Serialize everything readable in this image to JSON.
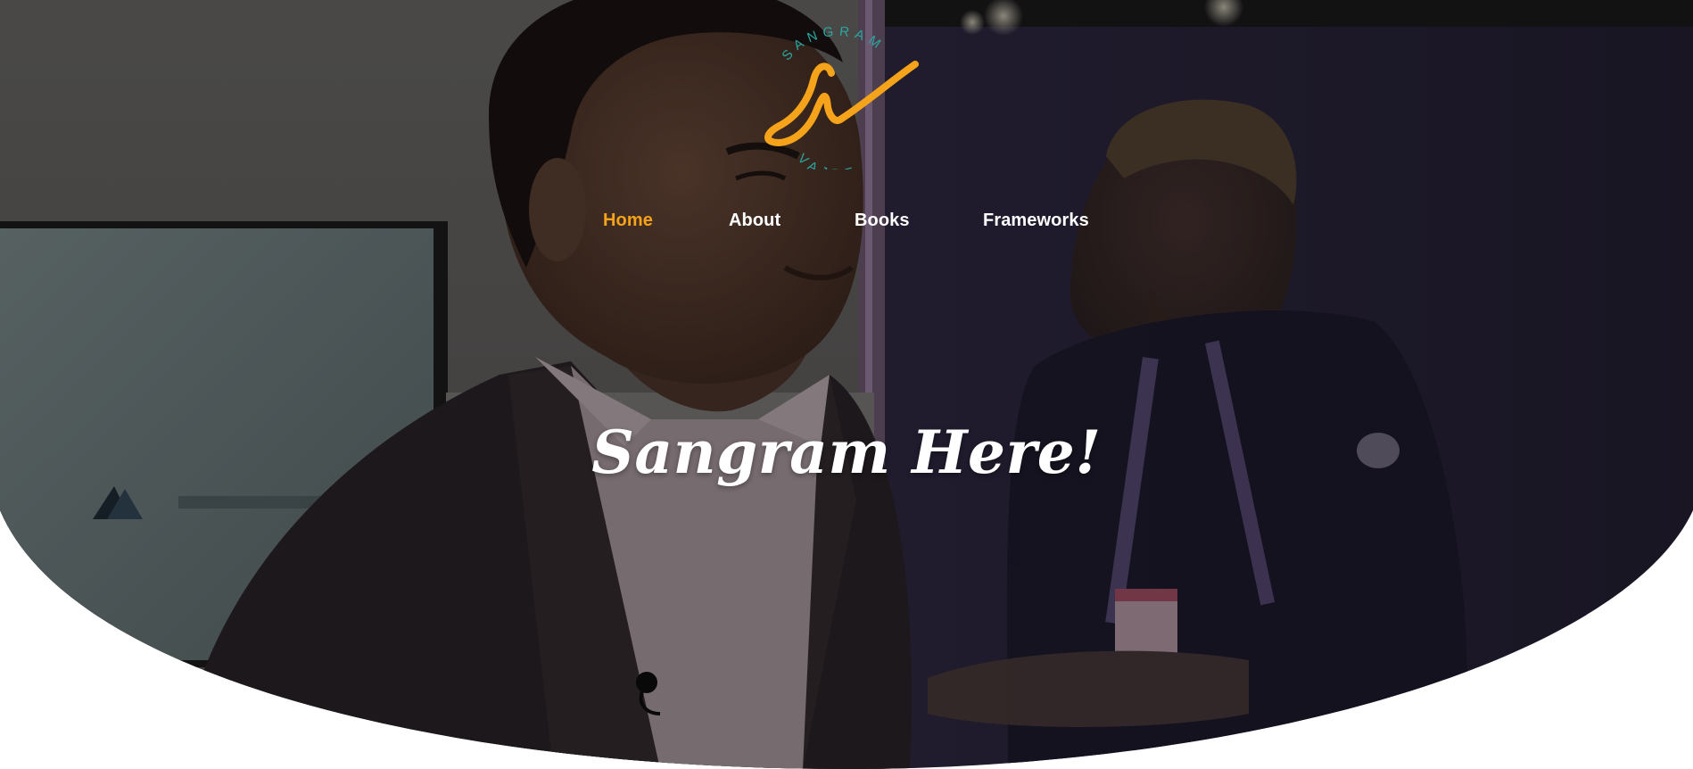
{
  "brand": {
    "logo_top_text": "SANGRAM",
    "logo_bottom_text": "VAJRE",
    "logo_mark_color": "#f5a31a",
    "logo_text_color": "#2aa7a0"
  },
  "nav": {
    "items": [
      {
        "label": "Home",
        "active": true
      },
      {
        "label": "About",
        "active": false
      },
      {
        "label": "Books",
        "active": false
      },
      {
        "label": "Frameworks",
        "active": false
      }
    ],
    "active_color": "#f5a31a",
    "default_color": "#ffffff"
  },
  "hero": {
    "headline": "Sangram Here!",
    "background_image": "photo-of-speaker"
  }
}
